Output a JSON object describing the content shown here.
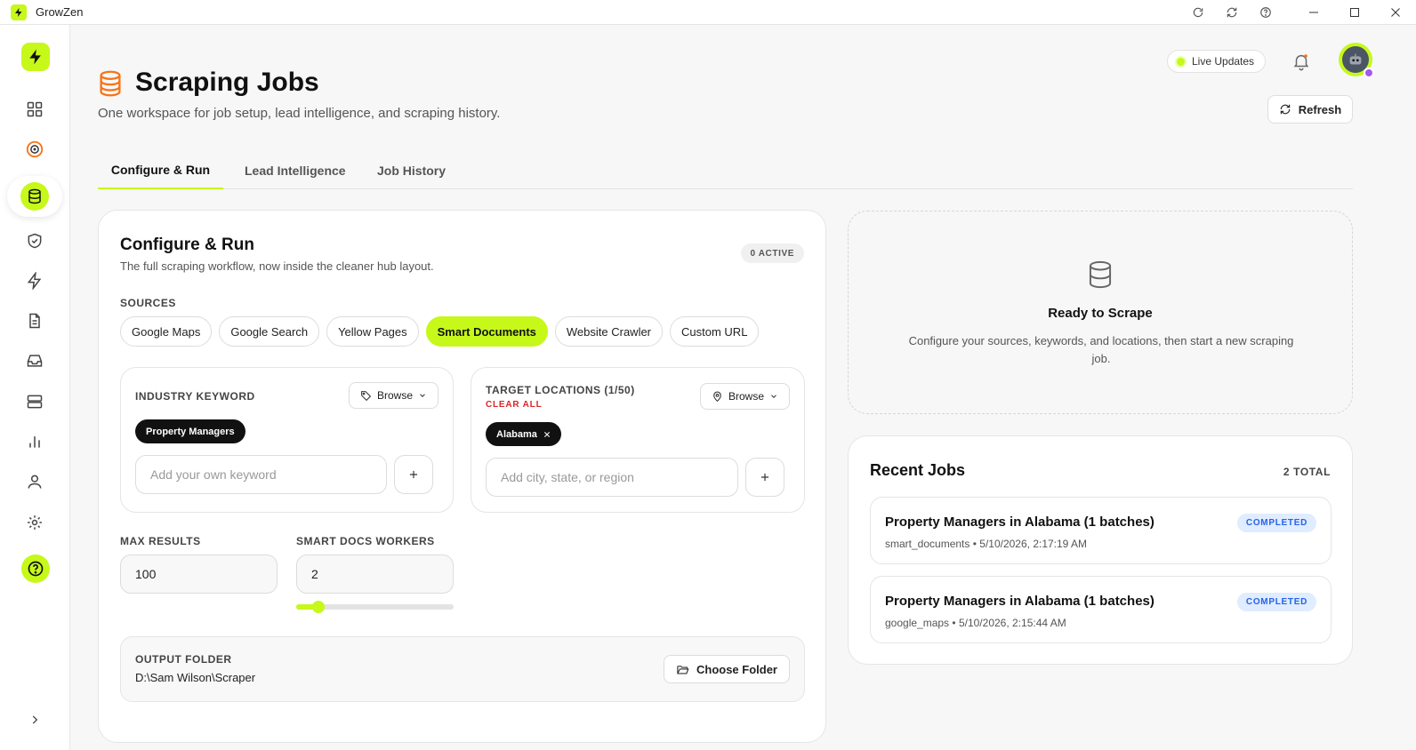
{
  "window": {
    "title": "GrowZen",
    "titlebar_icons": [
      "reload-icon",
      "sync-icon",
      "help-circle-icon"
    ],
    "controls": [
      "minimize-icon",
      "maximize-icon",
      "close-icon"
    ]
  },
  "sidebar": {
    "items": [
      "dashboard-icon",
      "target-icon",
      "database-icon",
      "shield-icon",
      "bolt-icon",
      "document-icon",
      "inbox-icon",
      "server-icon",
      "bar-chart-icon",
      "user-icon",
      "gear-icon"
    ],
    "active": "database-icon",
    "help": "help-icon",
    "expand": "chevron-right-icon"
  },
  "header": {
    "title": "Scraping Jobs",
    "subtitle": "One workspace for job setup, lead intelligence, and scraping history.",
    "live_updates": "Live Updates",
    "refresh": "Refresh"
  },
  "tabs": [
    {
      "label": "Configure & Run",
      "active": true
    },
    {
      "label": "Lead Intelligence",
      "active": false
    },
    {
      "label": "Job History",
      "active": false
    }
  ],
  "configure": {
    "title": "Configure & Run",
    "subtitle": "The full scraping workflow, now inside the cleaner hub layout.",
    "active_badge": "0 ACTIVE",
    "sources_label": "SOURCES",
    "sources": [
      "Google Maps",
      "Google Search",
      "Yellow Pages",
      "Smart Documents",
      "Website Crawler",
      "Custom URL"
    ],
    "active_source": "Smart Documents",
    "keyword": {
      "label": "INDUSTRY KEYWORD",
      "browse": "Browse",
      "tag": "Property Managers",
      "placeholder": "Add your own keyword"
    },
    "locations": {
      "label": "TARGET LOCATIONS (1/50)",
      "clear_all": "CLEAR ALL",
      "browse": "Browse",
      "tag": "Alabama",
      "placeholder": "Add city, state, or region"
    },
    "max_results": {
      "label": "MAX RESULTS",
      "value": "100"
    },
    "workers": {
      "label": "SMART DOCS WORKERS",
      "value": "2",
      "slider_fraction": 0.14
    },
    "output": {
      "label": "OUTPUT FOLDER",
      "path": "D:\\Sam Wilson\\Scraper",
      "button": "Choose Folder"
    }
  },
  "ready": {
    "title": "Ready to Scrape",
    "description": "Configure your sources, keywords, and locations, then start a new scraping job."
  },
  "recent_jobs": {
    "title": "Recent Jobs",
    "total": "2 TOTAL",
    "items": [
      {
        "name": "Property Managers in Alabama (1 batches)",
        "source": "smart_documents",
        "time": "5/10/2026, 2:17:19 AM",
        "status": "COMPLETED"
      },
      {
        "name": "Property Managers in Alabama (1 batches)",
        "source": "google_maps",
        "time": "5/10/2026, 2:15:44 AM",
        "status": "COMPLETED"
      }
    ],
    "separator": "•"
  },
  "colors": {
    "accent": "#c6f81a",
    "orange": "#f97316",
    "danger": "#dc2626",
    "status_blue": "#2563eb"
  }
}
